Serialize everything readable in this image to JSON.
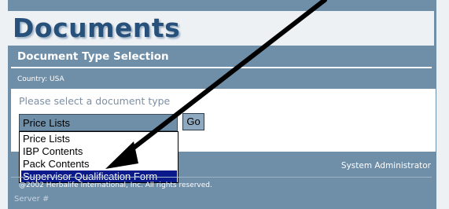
{
  "header": {
    "title": "Documents"
  },
  "section": {
    "heading": "Document Type Selection",
    "country": "Country: USA"
  },
  "form": {
    "prompt": "Please select a document type",
    "selected_value": "Price Lists",
    "go_label": "Go",
    "options": [
      "Price Lists",
      "IBP Contents",
      "Pack Contents",
      "Supervisor Qualification Form"
    ],
    "highlighted_option": "Supervisor Qualification Form"
  },
  "status": {
    "user": "System Administrator",
    "copyright": "@2002 Herbalife International, Inc. All rights reserved.",
    "server": "Server #"
  },
  "colors": {
    "frame": "#6f8ea8",
    "title": "#27517a",
    "highlight": "#0a1a8a",
    "arrow": "#000000"
  }
}
